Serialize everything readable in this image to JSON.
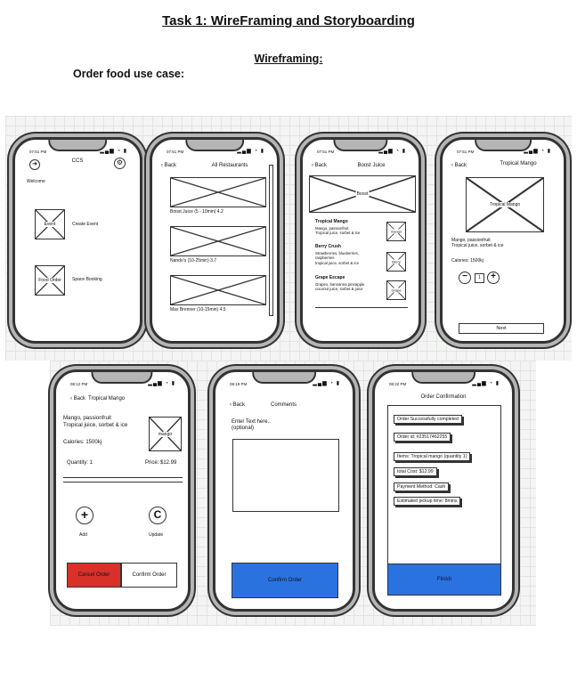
{
  "document": {
    "title": "Task 1: WireFraming and Storyboarding",
    "subtitle": "Wireframing:",
    "use_case": "Order food use case:"
  },
  "phones": {
    "welcome": {
      "time": "07:51 PM",
      "title": "CCS",
      "welcome": "Welcome",
      "event_label": "Event",
      "create_event": "Create Event",
      "food_order_label": "Food Order",
      "space_booking": "Space Booking"
    },
    "restaurants": {
      "time": "07:51 PM",
      "back": "Back",
      "title": "All Restaurants",
      "items": [
        "Boost Juice (5 - 10min) 4.2",
        "Nando's (10-25min) 3.7",
        "Max Brenner (10-15min) 4.5"
      ]
    },
    "boost": {
      "time": "07:51 PM",
      "back": "Back",
      "title": "Boost Juice",
      "banner": "Boost",
      "products": [
        {
          "name": "Tropical Mango",
          "desc1": "Mango, passionfruit",
          "desc2": "Tropical juice, sorbet & ice",
          "desc3": "",
          "thumb": "mango"
        },
        {
          "name": "Berry Crush",
          "desc1": "Strawberries, blueberries,",
          "desc2": "raspberries",
          "desc3": "tropical juice, sorbet & ice",
          "thumb": "Berry"
        },
        {
          "name": "Grape Escape",
          "desc1": "Grapes, bannanna pineapple",
          "desc2": "coconut juice, sorbet & juice",
          "desc3": "",
          "thumb": "Grape"
        }
      ]
    },
    "mango": {
      "time": "07:51 PM",
      "back": "Back",
      "title": "Tropical Mango",
      "image_label": "Tropical Mango",
      "desc1": "Mango, passionfruit",
      "desc2": "Tropical juice, sorbet & ice",
      "calories": "Calories: 1500kj",
      "qty": "1",
      "next": "Next"
    },
    "order": {
      "time": "08:12 PM",
      "back": "Back",
      "title": "Tropical Mango",
      "desc1": "Mango, passionfruit",
      "desc2": "Tropical juice, sorbet & ice",
      "thumb": "mango",
      "calories": "Calories: 1500kj",
      "quantity": "Quantity: 1",
      "price": "Price: $12.99",
      "add": "Add",
      "update": "Update",
      "cancel": "Cancel Order",
      "confirm": "Confirm Order"
    },
    "comments": {
      "time": "08:19 PM",
      "back": "Back",
      "title": "Comments",
      "hint1": "Enter Text here..",
      "hint2": "(optional)",
      "confirm": "Confirm Order"
    },
    "confirmation": {
      "time": "08:22 PM",
      "title": "Order Confirmation",
      "lines": [
        "Order Successfully completed",
        "Order id: #23517462255",
        "Items: Tropical mango (quantity 1)",
        "total Cost: $12.99",
        "Payment Method: Cash",
        "Estimated pickup time: 8mins"
      ],
      "finish": "Finish"
    }
  },
  "colors": {
    "cancel": "#d9302a",
    "primary": "#2a72e0",
    "frame": "#333333",
    "bezel": "#b5b5b5"
  },
  "icons": [
    "back-arrow-icon",
    "gear-icon",
    "signal-icon",
    "wifi-icon",
    "battery-icon",
    "minus-icon",
    "plus-icon",
    "refresh-icon"
  ]
}
